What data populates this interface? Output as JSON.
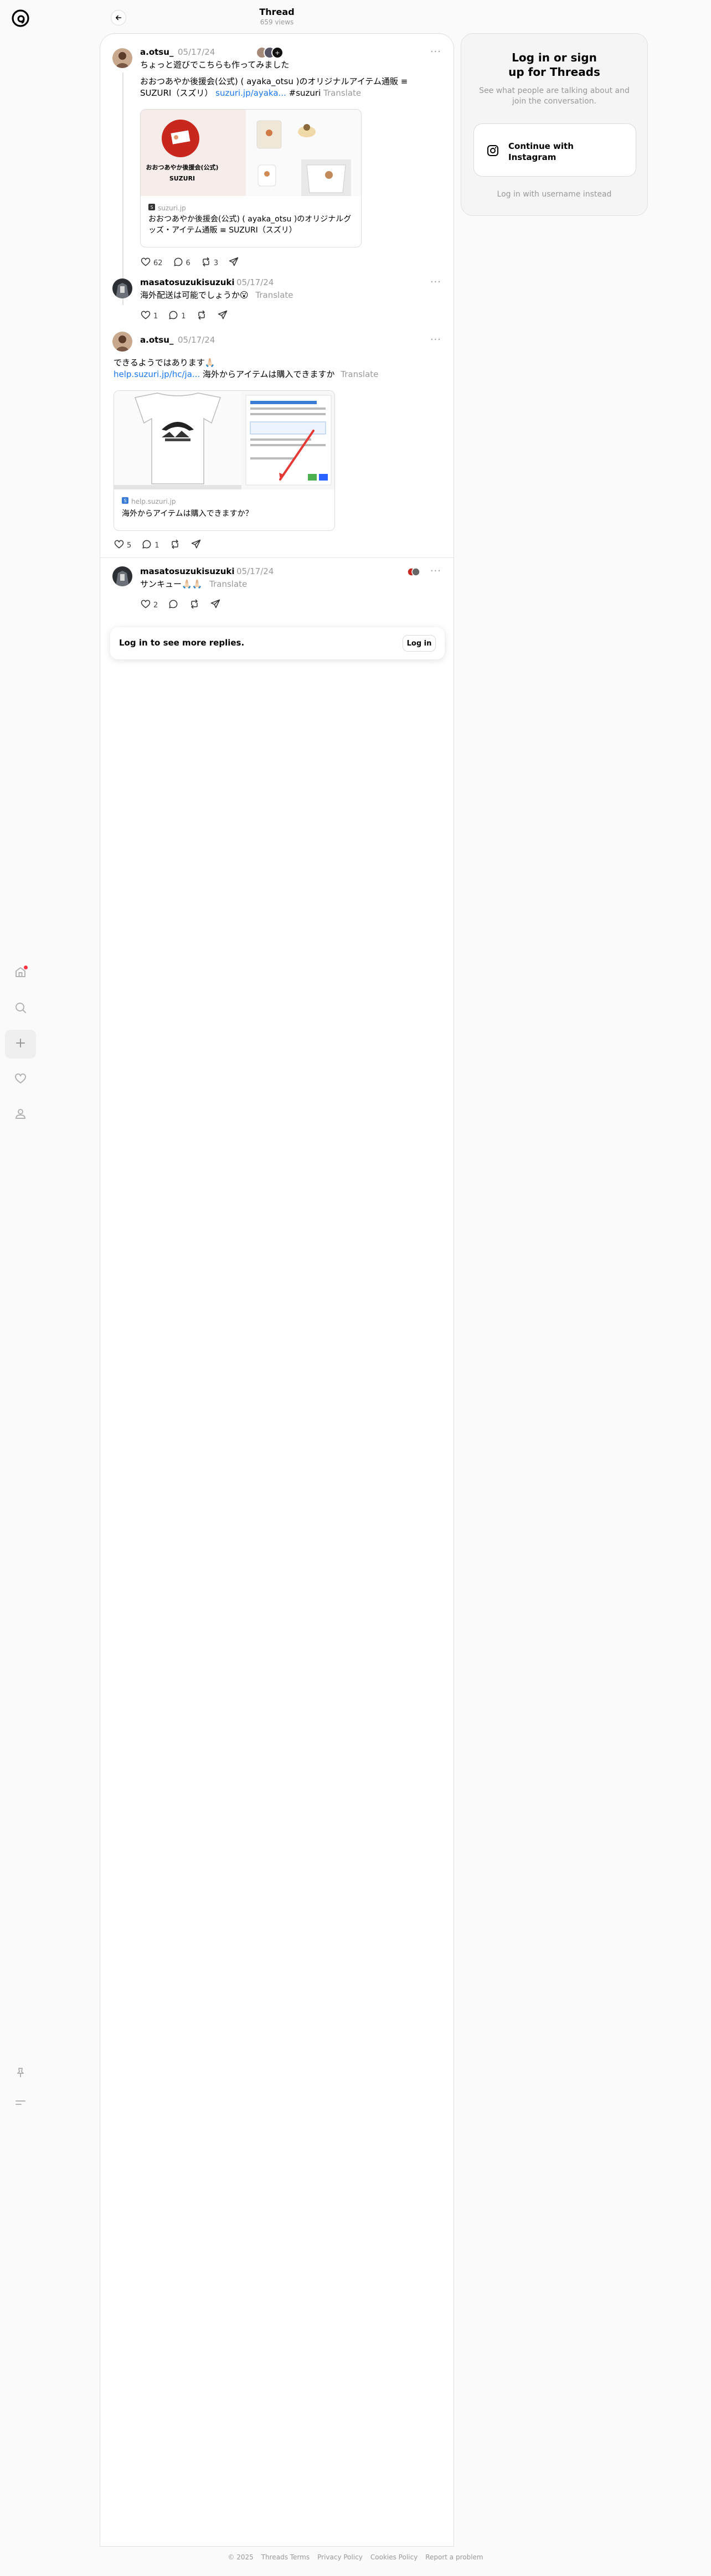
{
  "header": {
    "title": "Thread",
    "views": "659 views"
  },
  "nav": {
    "items": [
      {
        "name": "home-icon"
      },
      {
        "name": "search-icon"
      },
      {
        "name": "create-icon"
      },
      {
        "name": "heart-icon"
      },
      {
        "name": "profile-icon"
      }
    ],
    "bottom": [
      {
        "name": "pin-icon"
      },
      {
        "name": "menu-icon"
      }
    ]
  },
  "posts": [
    {
      "username": "a.otsu_",
      "date": "05/17/24",
      "line1": "ちょっと遊びでこちらも作ってみました",
      "line2": "おおつあやか後援会(公式) ( ayaka_otsu )のオリジナルアイテム通販 ≡",
      "line3_prefix": "SUZURI（スズリ）",
      "line3_link": "suzuri.jp/ayaka...",
      "line3_tag": "#suzuri",
      "translate": "Translate",
      "card": {
        "banner_text": "おおつあやか後援会(公式)",
        "banner_brand": "SUZURI",
        "domain": "suzuri.jp",
        "title": "おおつあやか後援会(公式) ( ayaka_otsu )のオリジナルグッズ・アイテム通販 ≡ SUZURI（スズリ）"
      },
      "likes": "62",
      "replies": "6",
      "reposts": "3"
    },
    {
      "username": "masatosuzukisuzuki",
      "date": "05/17/24",
      "text": "海外配送は可能でしょうか😮",
      "translate": "Translate",
      "likes": "1",
      "replies": "1"
    },
    {
      "username": "a.otsu_",
      "date": "05/17/24",
      "line1": "できるようではあります🙏🏻",
      "line2_link": "help.suzuri.jp/hc/ja...",
      "line2_text": "海外からアイテムは購入できますか",
      "translate": "Translate",
      "card": {
        "domain": "help.suzuri.jp",
        "title": "海外からアイテムは購入できますか？"
      },
      "likes": "5",
      "replies": "1"
    },
    {
      "username": "masatosuzukisuzuki",
      "date": "05/17/24",
      "text": "サンキュー🙏🏻🙏🏻",
      "translate": "Translate",
      "likes": "2"
    }
  ],
  "login_prompt": {
    "text": "Log in to see more replies.",
    "button": "Log in"
  },
  "right_panel": {
    "title": "Log in or sign up for Threads",
    "subtitle": "See what people are talking about and join the conversation.",
    "instagram_button": "Continue with Instagram",
    "username_link": "Log in with username instead"
  },
  "footer": {
    "copyright": "© 2025",
    "links": [
      "Threads Terms",
      "Privacy Policy",
      "Cookies Policy",
      "Report a problem"
    ]
  },
  "colors": {
    "link": "#1877f2",
    "notification": "#ff3040",
    "muted": "#999999"
  }
}
